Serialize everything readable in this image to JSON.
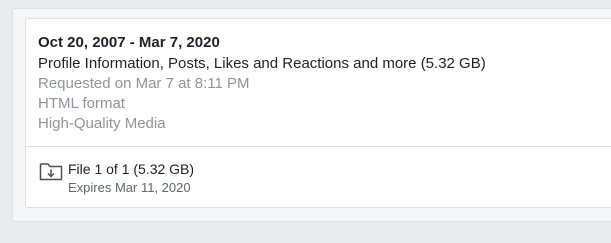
{
  "archive": {
    "date_range": "Oct 20, 2007 - Mar 7, 2020",
    "description": "Profile Information, Posts, Likes and Reactions and more (5.32 GB)",
    "requested": "Requested on Mar 7 at 8:11 PM",
    "format": "HTML format",
    "media_quality": "High-Quality Media"
  },
  "file": {
    "icon": "download-folder-icon",
    "title": "File 1 of 1 (5.32 GB)",
    "expires": "Expires Mar 11, 2020"
  },
  "colors": {
    "primary_text": "#1d2129",
    "secondary_text": "#90949c",
    "border": "#dddfe2",
    "page_background": "#e9ebee"
  }
}
